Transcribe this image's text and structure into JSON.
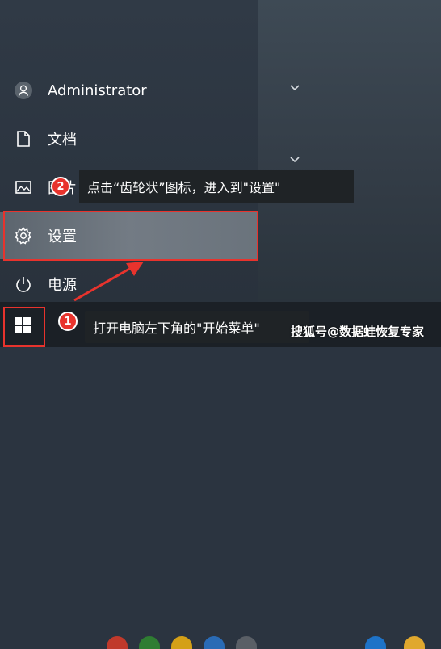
{
  "start_menu": {
    "user": {
      "label": "Administrator"
    },
    "documents": {
      "label": "文档"
    },
    "pictures": {
      "label": "图片"
    },
    "settings": {
      "label": "设置"
    },
    "power": {
      "label": "电源"
    }
  },
  "annotations": {
    "step1": {
      "number": "1",
      "text": "打开电脑左下角的\"开始菜单\""
    },
    "step2": {
      "number": "2",
      "text": "点击“齿轮状”图标，进入到\"设置\""
    }
  },
  "watermark": {
    "text": "搜狐号@数据蛙恢复专家"
  },
  "colors": {
    "highlight_red": "#e8332d",
    "callout_bg": "#1f2326",
    "settings_highlight": "#737b84"
  },
  "icons": [
    "user-icon",
    "document-icon",
    "picture-icon",
    "gear-icon",
    "power-icon",
    "windows-logo-icon",
    "chevron-down-icon"
  ]
}
